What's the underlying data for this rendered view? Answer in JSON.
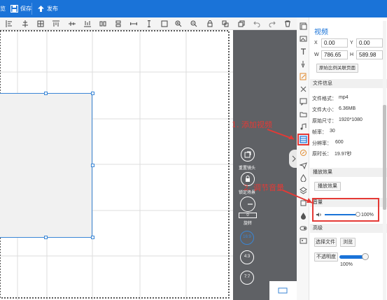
{
  "topbar": {
    "bg": "#1a73d8",
    "partial_label": "览",
    "save_label": "保存",
    "publish_label": "发布"
  },
  "controls": {
    "adjust_frame": "重置镜头",
    "lock_scene": "锁定场景",
    "rotate_value": "0",
    "rotate_label": "旋转",
    "ratio_16_9": "16:9",
    "ratio_4_3": "4:3",
    "ratio_7_7": "7:7"
  },
  "panel": {
    "title": "视频",
    "x_label": "X",
    "x_value": "0.00",
    "y_label": "Y",
    "y_value": "0.00",
    "w_label": "W",
    "w_value": "786.65",
    "h_label": "H",
    "h_value": "589.98",
    "ratio_button": "原始比例关联页面",
    "file_info_header": "文件信息",
    "file_format_label": "文件格式：",
    "file_format_value": "mp4",
    "file_size_label": "文件大小：",
    "file_size_value": "6.36MB",
    "orig_size_label": "原始尺寸：",
    "orig_size_value": "1920*1080",
    "fps_label": "帧率：",
    "fps_value": "30",
    "bitrate_label": "分辨率：",
    "bitrate_value": "600",
    "duration_label": "原时长：",
    "duration_value": "19.97秒",
    "effects_header": "播放效果",
    "effects_button": "播放效果",
    "volume_header": "音量",
    "volume_value": "100%",
    "volume_level": 1.0,
    "advanced_header": "高级",
    "select_file_button": "选择文件",
    "browse_button": "浏览",
    "opacity_label": "不透明度",
    "opacity_value": "100%",
    "opacity_level": 1.0
  },
  "annotations": {
    "step1": "1. 添加视频",
    "step2": "2. 调节音量",
    "color": "#e53935"
  }
}
